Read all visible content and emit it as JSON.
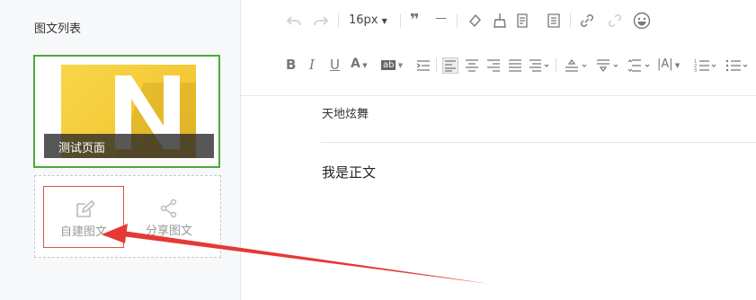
{
  "sidebar": {
    "title": "图文列表",
    "card": {
      "caption": "测试页面",
      "thumb_letter": "N"
    },
    "actions": {
      "create_label": "自建图文",
      "share_label": "分享图文"
    }
  },
  "toolbar": {
    "font_size": "16px",
    "bold": "B",
    "italic": "I",
    "underline": "U",
    "font_color": "A",
    "highlight": "ab"
  },
  "editor": {
    "subtitle": "天地炫舞",
    "body": "我是正文"
  },
  "colors": {
    "card_border": "#4aaa3a",
    "create_border": "#d9534f",
    "arrow": "#e53935",
    "thumb": "#f3c93c"
  }
}
